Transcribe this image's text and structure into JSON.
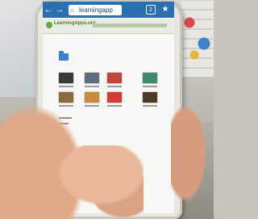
{
  "browser": {
    "url": "learningapp",
    "icons": {
      "back": "back-arrow-icon",
      "forward": "forward-arrow-icon",
      "home": "home-icon",
      "lock": "lock-icon",
      "tabs": "tabs-icon",
      "bookmark": "bookmark-icon"
    }
  },
  "page": {
    "header_title": "LearningApps.org"
  },
  "colors": {
    "browser_bar": "#2a6fb2",
    "folder_blue": "#3c7fd0",
    "folder_yellow": "#e2b33b"
  },
  "thumbnails": [
    {
      "color": "#3a3a3a"
    },
    {
      "color": "#5d6d7b"
    },
    {
      "color": "#c2443b"
    },
    {
      "color": "#3d8b6c"
    },
    {
      "color": "#8a6b3d"
    },
    {
      "color": "#c98c3a"
    },
    {
      "color": "#d53b36"
    },
    {
      "color": "#4f3a25"
    }
  ]
}
